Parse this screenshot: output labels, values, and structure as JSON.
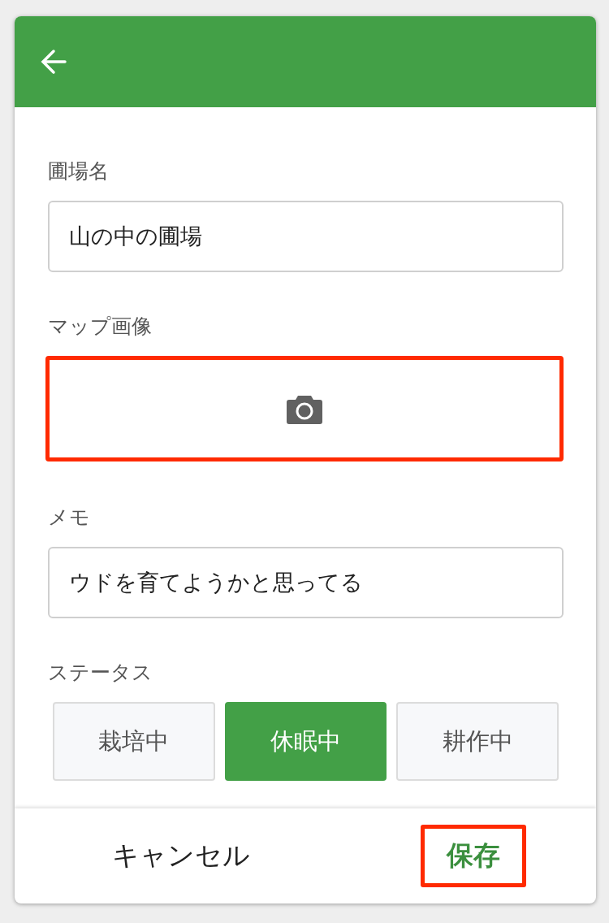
{
  "fields": [
    {
      "kind": "text",
      "label": "圃場名",
      "value": "山の中の圃場",
      "highlighted": false
    },
    {
      "kind": "image",
      "label": "マップ画像",
      "highlighted": true
    },
    {
      "kind": "text",
      "label": "メモ",
      "value": "ウドを育てようかと思ってる",
      "highlighted": false
    }
  ],
  "status": {
    "label": "ステータス",
    "options": [
      {
        "label": "栽培中",
        "selected": false
      },
      {
        "label": "休眠中",
        "selected": true
      },
      {
        "label": "耕作中",
        "selected": false
      }
    ]
  },
  "footer": {
    "cancel": {
      "label": "キャンセル",
      "highlighted": false
    },
    "save": {
      "label": "保存",
      "highlighted": true
    }
  }
}
